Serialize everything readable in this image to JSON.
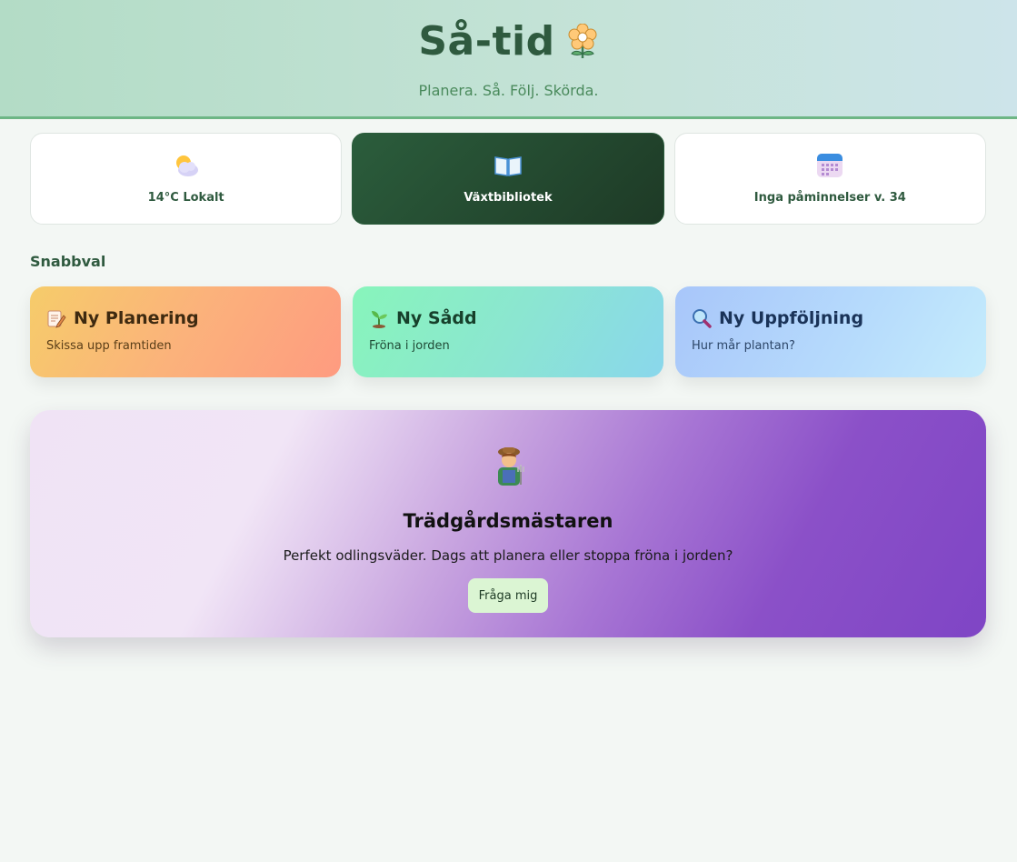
{
  "app": {
    "title": "Så-tid",
    "subtitle": "Planera. Så. Följ. Skörda."
  },
  "status_cards": [
    {
      "label": "14°C Lokalt",
      "icon": "weather-cloud-sun-icon"
    },
    {
      "label": "Växtbibliotek",
      "icon": "open-book-icon",
      "active": true
    },
    {
      "label": "Inga påminnelser v. 34",
      "icon": "calendar-icon"
    }
  ],
  "quick_section": {
    "title": "Snabbval",
    "cards": [
      {
        "title": "Ny Planering",
        "subtitle": "Skissa upp framtiden",
        "icon": "memo-pencil-icon"
      },
      {
        "title": "Ny Sådd",
        "subtitle": "Fröna i jorden",
        "icon": "seedling-icon"
      },
      {
        "title": "Ny Uppföljning",
        "subtitle": "Hur mår plantan?",
        "icon": "magnifier-icon"
      }
    ]
  },
  "assistant": {
    "icon": "gardener-icon",
    "title": "Trädgårdsmästaren",
    "message": "Perfekt odlingsväder. Dags att planera eller stoppa fröna i jorden?",
    "button_label": "Fråga mig"
  },
  "colors": {
    "header_gradient_start": "#b3dcc6",
    "header_border": "#6db685",
    "brand_dark_green": "#2f5a3f",
    "active_card": "#2b5d3c",
    "assistant_purple": "#7f45c5"
  }
}
